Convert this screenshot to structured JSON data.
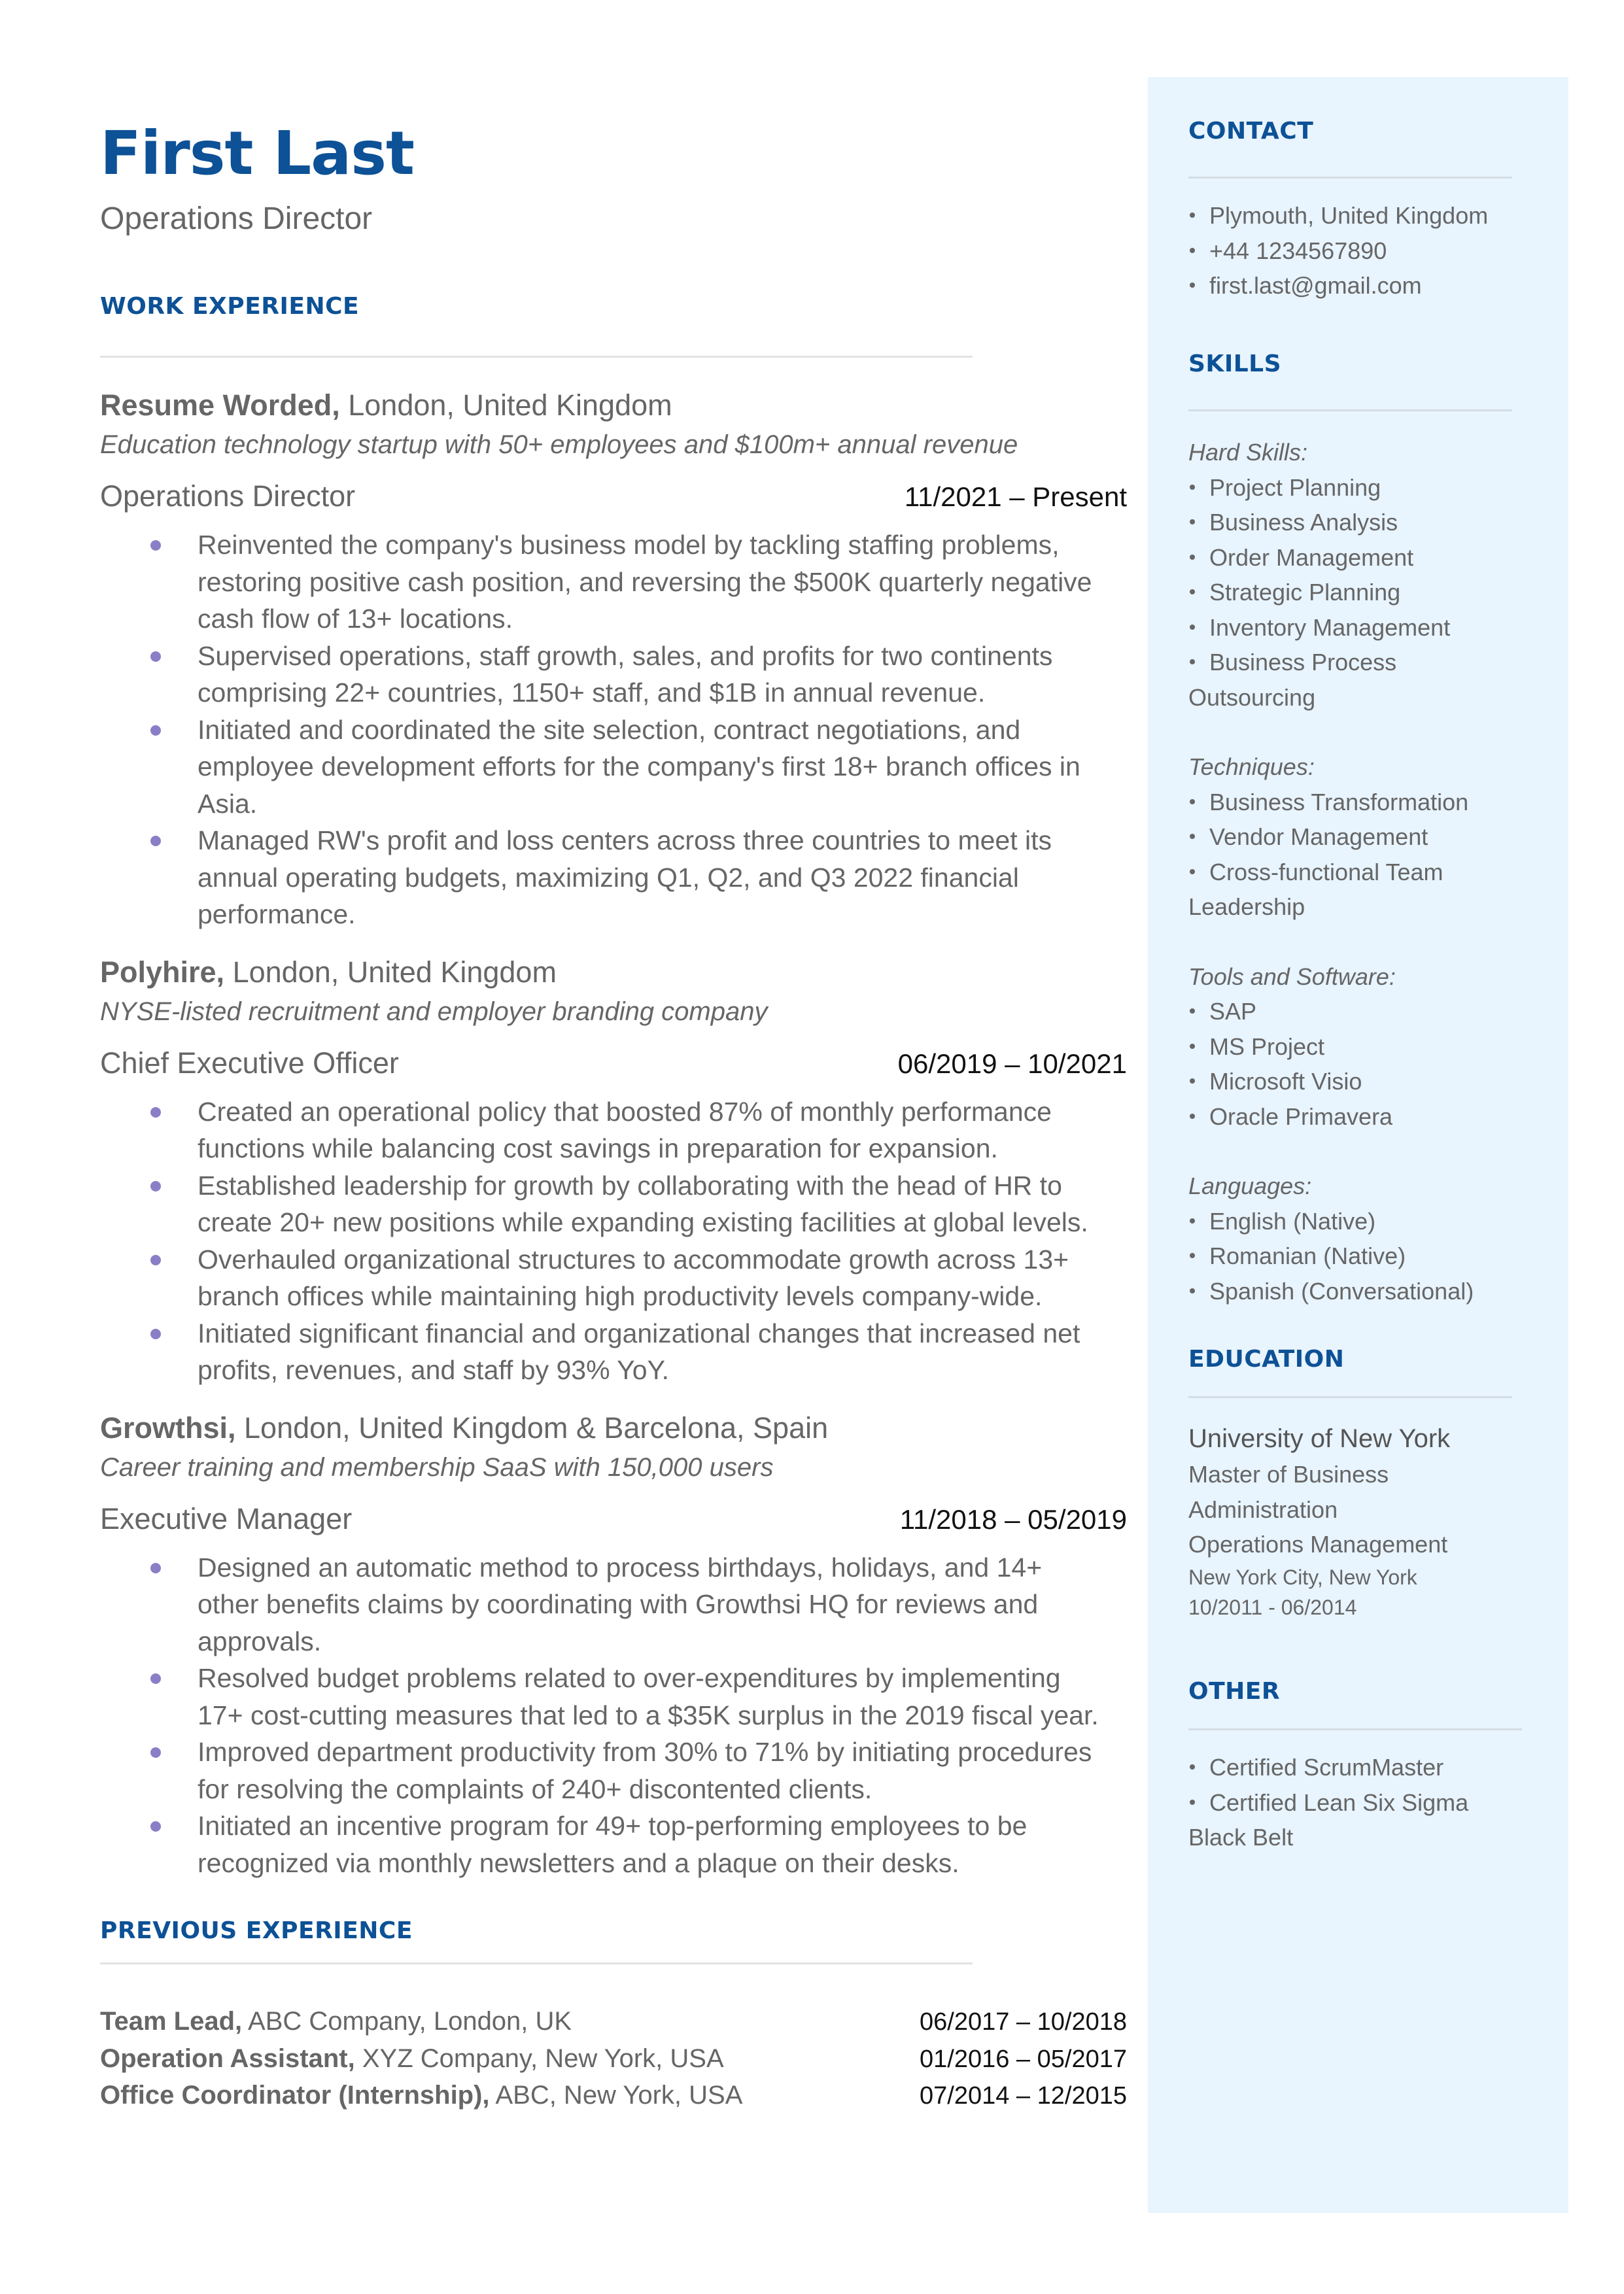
{
  "header": {
    "name": "First Last",
    "headline": "Operations Director"
  },
  "colors": {
    "accent": "#0d5196",
    "bullet": "#8a7fc6",
    "sidebar_bg": "#e8f4fe",
    "text": "#666666",
    "date_text": "#111111"
  },
  "work_experience": {
    "title": "WORK EXPERIENCE",
    "jobs": [
      {
        "company": "Resume Worded,",
        "location": " London, United Kingdom",
        "description": "Education technology startup with 50+ employees and $100m+ annual revenue",
        "role": "Operations Director",
        "dates": "11/2021 – Present",
        "bullets": [
          "Reinvented the company's business model by tackling staffing problems, restoring positive cash position, and reversing the $500K quarterly negative cash flow of 13+ locations.",
          "Supervised operations, staff growth, sales, and profits for two continents comprising 22+ countries, 1150+ staff, and $1B in annual revenue.",
          "Initiated and coordinated the site selection, contract negotiations, and employee development efforts for the company's first 18+ branch offices in Asia.",
          "Managed RW's profit and loss centers across three countries to meet its annual operating budgets, maximizing Q1, Q2, and Q3 2022 financial performance."
        ]
      },
      {
        "company": "Polyhire,",
        "location": " London, United Kingdom",
        "description": "NYSE-listed recruitment and employer branding company",
        "role": "Chief Executive Officer",
        "dates": "06/2019 – 10/2021",
        "bullets": [
          "Created an operational policy that boosted 87% of monthly performance functions while balancing cost savings in preparation for expansion.",
          "Established leadership for growth by collaborating with the head of HR to create 20+ new positions while expanding existing facilities at global levels.",
          "Overhauled organizational structures to accommodate growth across 13+ branch offices while maintaining high productivity levels company-wide.",
          "Initiated significant financial and organizational changes that increased net profits, revenues, and staff by 93% YoY."
        ]
      },
      {
        "company": "Growthsi,",
        "location": " London, United Kingdom & Barcelona, Spain",
        "description": "Career training and membership SaaS with 150,000 users",
        "role": "Executive Manager",
        "dates": "11/2018 – 05/2019",
        "bullets": [
          "Designed an automatic method to process birthdays, holidays, and 14+ other benefits claims by coordinating with Growthsi HQ for reviews and approvals.",
          "Resolved budget problems related to over-expenditures by implementing 17+ cost-cutting measures that led to a $35K surplus in the 2019 fiscal year.",
          "Improved department productivity from 30% to 71% by initiating procedures for resolving the complaints of 240+ discontented clients.",
          "Initiated an incentive program for 49+ top-performing employees to be recognized via monthly newsletters and a plaque on their desks."
        ]
      }
    ]
  },
  "previous_experience": {
    "title": "PREVIOUS EXPERIENCE",
    "items": [
      {
        "role": "Team Lead,",
        "details": " ABC Company, London, UK",
        "dates": "06/2017 – 10/2018"
      },
      {
        "role": "Operation Assistant,",
        "details": " XYZ Company, New York, USA",
        "dates": "01/2016 – 05/2017"
      },
      {
        "role": "Office Coordinator (Internship),",
        "details": " ABC, New York, USA",
        "dates": "07/2014 – 12/2015"
      }
    ]
  },
  "sidebar": {
    "contact": {
      "title": "CONTACT",
      "items": [
        "Plymouth, United Kingdom",
        "+44 1234567890",
        "first.last@gmail.com"
      ]
    },
    "skills": {
      "title": "SKILLS",
      "groups": [
        {
          "label": "Hard Skills:",
          "items": [
            "Project Planning",
            "Business Analysis",
            "Order Management",
            "Strategic Planning",
            "Inventory Management",
            "Business Process Outsourcing"
          ]
        },
        {
          "label": "Techniques:",
          "items": [
            "Business Transformation",
            "Vendor Management",
            "Cross-functional Team Leadership"
          ]
        },
        {
          "label": "Tools and Software:",
          "items": [
            "SAP",
            "MS Project",
            "Microsoft Visio",
            "Oracle Primavera"
          ]
        },
        {
          "label": "Languages:",
          "items": [
            "English (Native)",
            "Romanian (Native)",
            "Spanish (Conversational)"
          ]
        }
      ]
    },
    "education": {
      "title": "EDUCATION",
      "school": "University of New York",
      "degree": "Master of Business Administration",
      "field": "Operations Management",
      "location": "New York City, New York",
      "dates": "10/2011 - 06/2014"
    },
    "other": {
      "title": "OTHER",
      "items": [
        "Certified ScrumMaster",
        "Certified Lean Six Sigma Black Belt"
      ]
    }
  }
}
